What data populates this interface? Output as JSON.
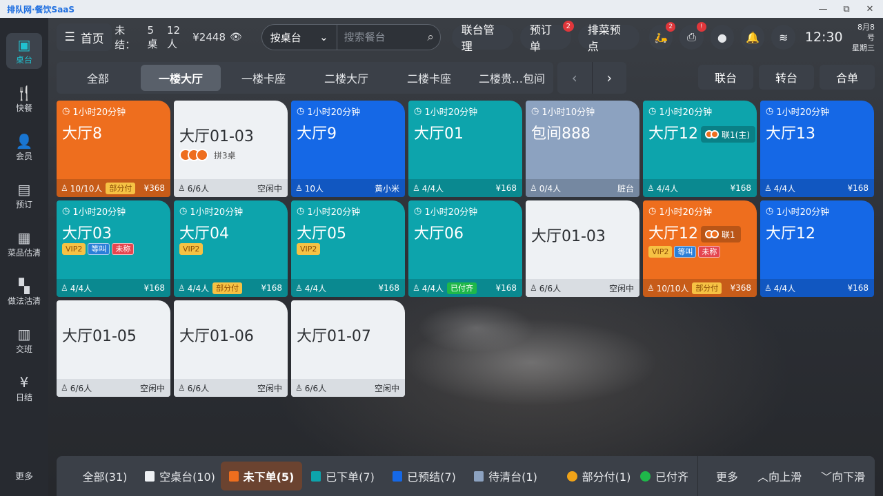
{
  "app": {
    "title": "排队网·餐饮SaaS"
  },
  "window": {
    "minimize": "—",
    "restore": "⧉",
    "close": "✕"
  },
  "sidebar": {
    "items": [
      {
        "label": "桌台",
        "icon": "table-icon",
        "glyph": "▣",
        "active": true
      },
      {
        "label": "快餐",
        "icon": "cutlery-icon",
        "glyph": "🍴"
      },
      {
        "label": "会员",
        "icon": "user-icon",
        "glyph": "👤"
      },
      {
        "label": "预订",
        "icon": "booking-icon",
        "glyph": "▤"
      },
      {
        "label": "菜品估清",
        "icon": "box-icon",
        "glyph": "▦"
      },
      {
        "label": "做法沽清",
        "icon": "grid-icon",
        "glyph": "▚"
      },
      {
        "label": "交班",
        "icon": "handover-icon",
        "glyph": "▥"
      },
      {
        "label": "日结",
        "icon": "calendar-yen-icon",
        "glyph": "¥"
      }
    ],
    "more": "更多"
  },
  "topbar": {
    "home": "首页",
    "summary_label": "未结：",
    "summary_tables": "5桌",
    "summary_people": "12人",
    "summary_amount": "¥2448",
    "select_value": "按桌台",
    "search_placeholder": "搜索餐台",
    "btn_merge_manage": "联台管理",
    "btn_preorder": "预订单",
    "preorder_badge": "2",
    "btn_dish_preorder": "排菜预点",
    "delivery_badge": "2",
    "printer_badge": "!",
    "time": "12:30",
    "date": "8月8号",
    "weekday": "星期三"
  },
  "area_tabs": [
    "全部",
    "一楼大厅",
    "一楼卡座",
    "二楼大厅",
    "二楼卡座",
    "二楼贵…包间"
  ],
  "area_active": 1,
  "pager": {
    "prev": "‹",
    "next": "›"
  },
  "ops": [
    "联台",
    "转台",
    "合单"
  ],
  "tables": [
    {
      "color": "orange",
      "time": "1小时20分钟",
      "name": "大厅8",
      "people": "10/10人",
      "tag": "部分付",
      "right": "¥368"
    },
    {
      "color": "white",
      "time": "",
      "name": "大厅01-03",
      "people": "6/6人",
      "right": "空闲中",
      "pin": "拼3桌"
    },
    {
      "color": "blue",
      "time": "1小时20分钟",
      "name": "大厅9",
      "people": "10人",
      "right": "黄小米"
    },
    {
      "color": "teal",
      "time": "1小时20分钟",
      "name": "大厅01",
      "people": "4/4人",
      "right": "¥168"
    },
    {
      "color": "gray",
      "time": "1小时10分钟",
      "name": "包间888",
      "people": "0/4人",
      "right": "脏台"
    },
    {
      "color": "teal",
      "time": "1小时20分钟",
      "name": "大厅12",
      "merge": "联1(主)",
      "people": "4/4人",
      "right": "¥168"
    },
    {
      "color": "blue",
      "time": "1小时20分钟",
      "name": "大厅13",
      "people": "4/4人",
      "right": "¥168"
    },
    {
      "color": "teal",
      "time": "1小时20分钟",
      "name": "大厅03",
      "tags": [
        "VIP2",
        "等叫",
        "未称"
      ],
      "people": "4/4人",
      "right": "¥168"
    },
    {
      "color": "teal",
      "time": "1小时20分钟",
      "name": "大厅04",
      "tags": [
        "VIP2"
      ],
      "people": "4/4人",
      "tag": "部分付",
      "right": "¥168"
    },
    {
      "color": "teal",
      "time": "1小时20分钟",
      "name": "大厅05",
      "tags": [
        "VIP2"
      ],
      "people": "4/4人",
      "right": "¥168"
    },
    {
      "color": "teal",
      "time": "1小时20分钟",
      "name": "大厅06",
      "people": "4/4人",
      "tag": "已付齐",
      "right": "¥168"
    },
    {
      "color": "white",
      "time": "",
      "name": "大厅01-03",
      "people": "6/6人",
      "right": "空闲中"
    },
    {
      "color": "orange",
      "time": "1小时20分钟",
      "name": "大厅12",
      "merge": "联1",
      "tags": [
        "VIP2",
        "等叫",
        "未称"
      ],
      "people": "10/10人",
      "tag": "部分付",
      "right": "¥368"
    },
    {
      "color": "blue",
      "time": "1小时20分钟",
      "name": "大厅12",
      "people": "4/4人",
      "right": "¥168"
    },
    {
      "color": "white",
      "time": "",
      "name": "大厅01-05",
      "people": "6/6人",
      "right": "空闲中"
    },
    {
      "color": "white",
      "time": "",
      "name": "大厅01-06",
      "people": "6/6人",
      "right": "空闲中"
    },
    {
      "color": "white",
      "time": "",
      "name": "大厅01-07",
      "people": "6/6人",
      "right": "空闲中"
    }
  ],
  "filters": [
    {
      "label": "全部(31)"
    },
    {
      "label": "空桌台(10)",
      "swatch": "#eef1f4",
      "shape": "sq"
    },
    {
      "label": "未下单(5)",
      "swatch": "#ee6e1e",
      "shape": "sq",
      "active": true
    },
    {
      "label": "已下单(7)",
      "swatch": "#0da4ac",
      "shape": "sq"
    },
    {
      "label": "已预结(7)",
      "swatch": "#1568e6",
      "shape": "sq"
    },
    {
      "label": "待清台(1)",
      "swatch": "#8ca2c0",
      "shape": "sq"
    },
    {
      "label": "部分付(1)",
      "swatch": "#f0a318",
      "shape": "dot"
    },
    {
      "label": "已付齐",
      "swatch": "#1fb84a",
      "shape": "dot"
    }
  ],
  "bottom_right": {
    "more": "更多",
    "up": "向上滑",
    "down": "向下滑"
  }
}
